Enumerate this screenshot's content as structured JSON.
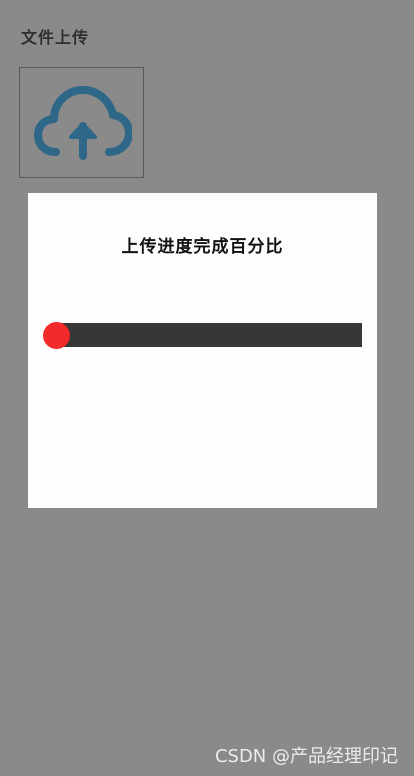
{
  "header": {
    "title": "文件上传"
  },
  "upload": {
    "icon": "cloud-upload-icon",
    "icon_color": "#2f6789"
  },
  "progress_dialog": {
    "title": "上传进度完成百分比",
    "progress_percent": 0,
    "track_color": "#373737",
    "knob_color": "#f22a2a"
  },
  "watermark": {
    "text": "CSDN @产品经理印记"
  }
}
